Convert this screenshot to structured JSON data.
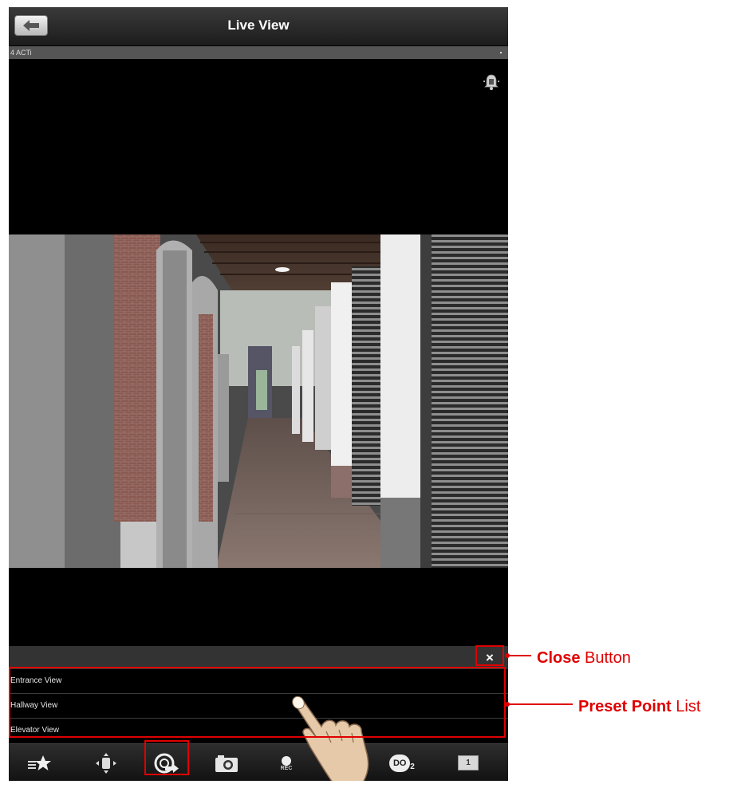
{
  "header": {
    "title": "Live View",
    "back_icon": "back-arrow-icon"
  },
  "channel": {
    "name": "4 ACTi"
  },
  "alarm_icon": "alarm-bell-icon",
  "preset_panel": {
    "close_label": "×",
    "items": [
      {
        "label": "Entrance View"
      },
      {
        "label": "Hallway View"
      },
      {
        "label": "Elevator View"
      }
    ]
  },
  "toolbar": {
    "items": [
      {
        "icon": "favorites-star-icon"
      },
      {
        "icon": "ptz-control-icon"
      },
      {
        "icon": "preset-point-icon"
      },
      {
        "icon": "snapshot-camera-icon"
      },
      {
        "icon": "record-icon",
        "label": "REC"
      },
      {
        "icon": "digital-output-icon",
        "label": "DO",
        "sub": "2"
      },
      {
        "icon": "display-mode-icon",
        "label": "1"
      }
    ]
  },
  "annotations": {
    "close_button": {
      "bold": "Close",
      "rest": " Button"
    },
    "preset_list": {
      "bold": "Preset Point",
      "rest": " List"
    }
  },
  "colors": {
    "annotation_red": "#e00000",
    "app_background": "#000000",
    "title_bar": "#2a2a2a"
  }
}
